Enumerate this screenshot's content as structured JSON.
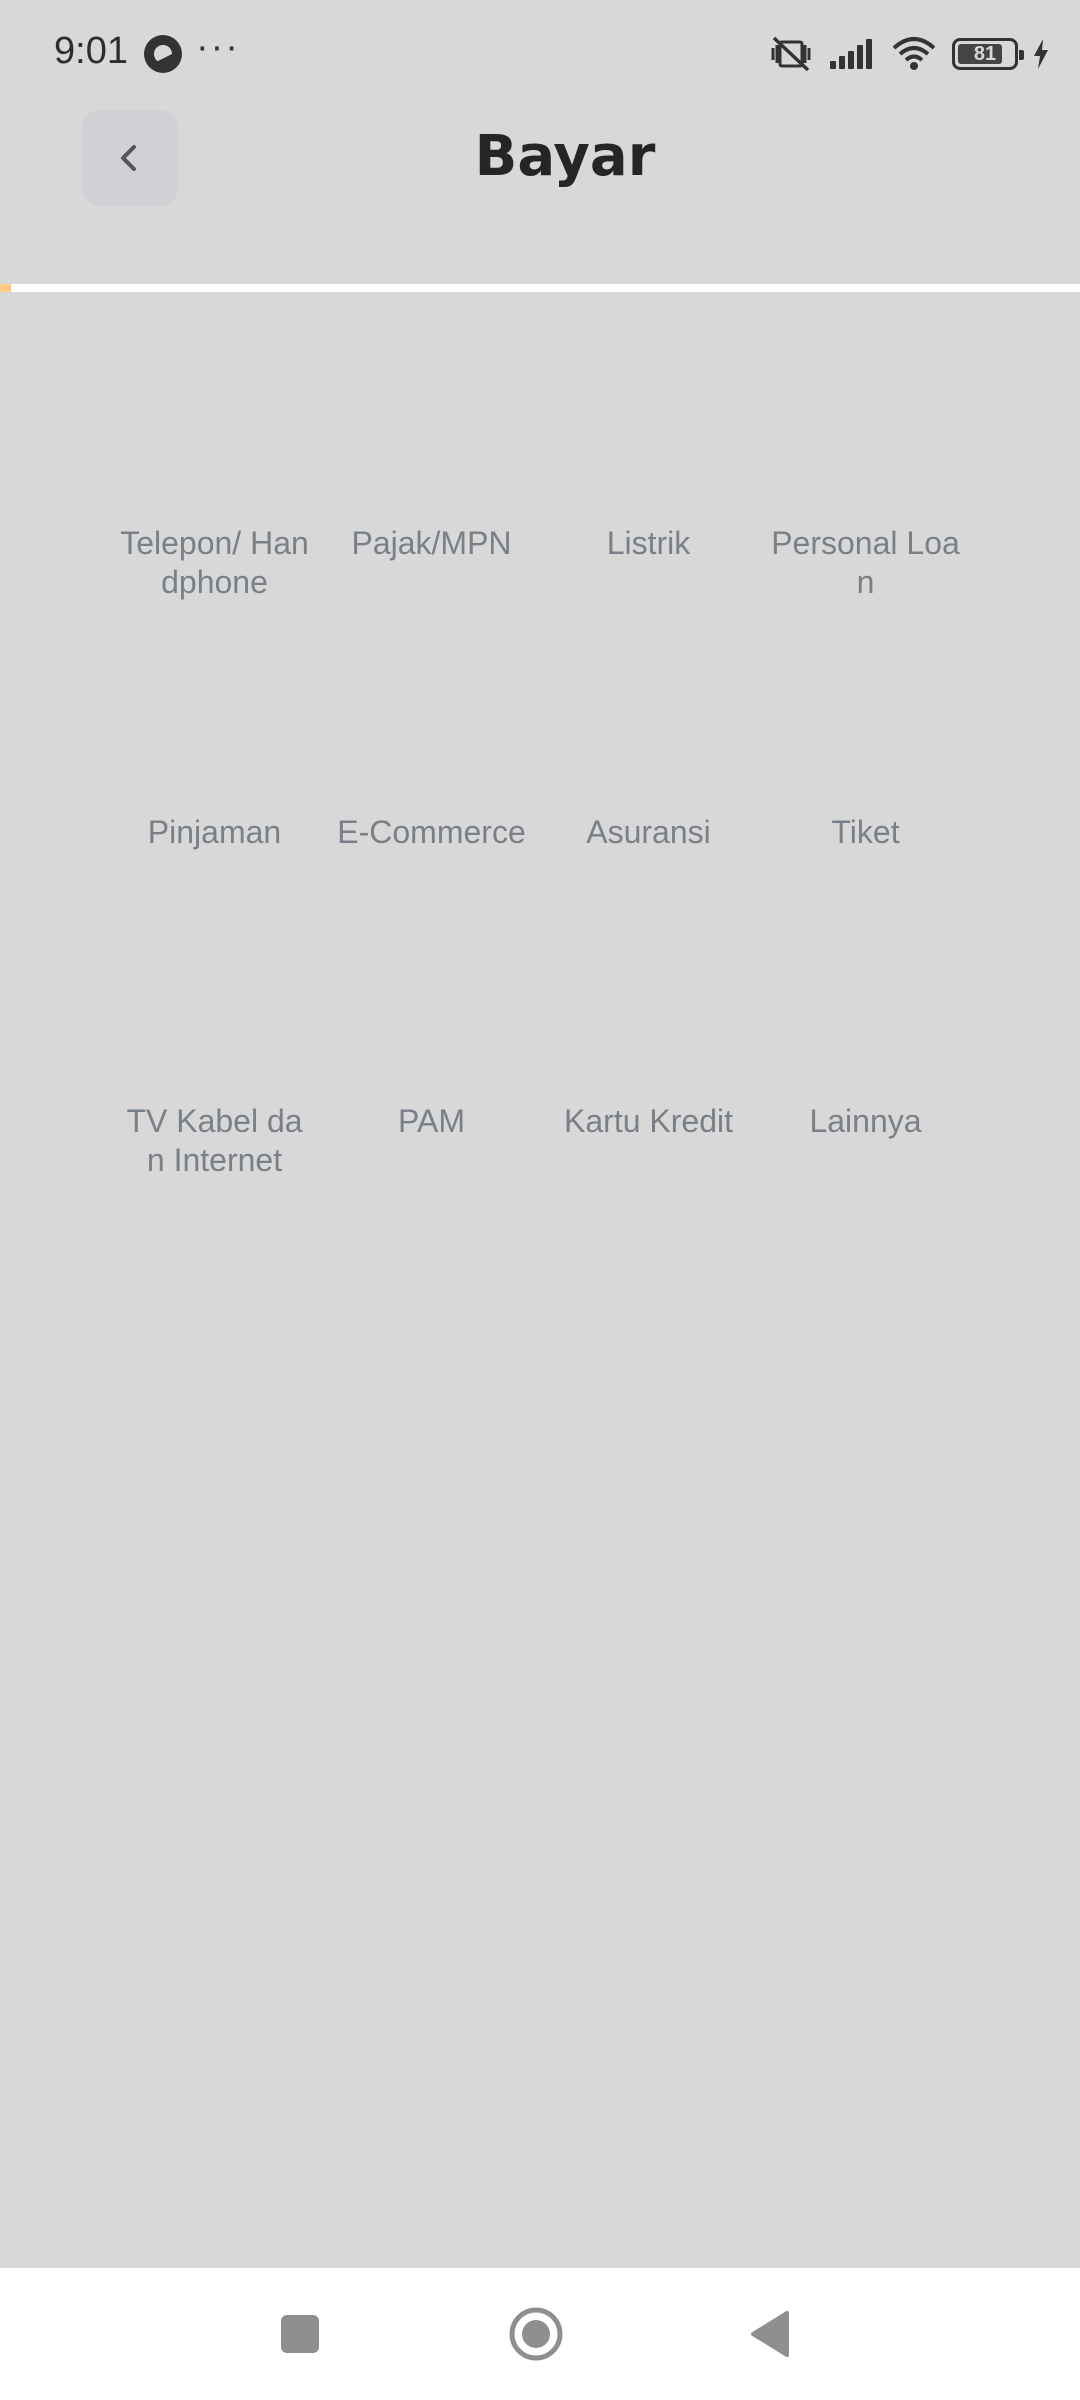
{
  "status_bar": {
    "time": "9:01",
    "more": "···",
    "battery_level": "81",
    "battery_fraction": 0.81
  },
  "header": {
    "title": "Bayar",
    "back_icon": "chevron-left-icon"
  },
  "progress": {
    "fraction": 0.01,
    "color": "#ffc987"
  },
  "grid": {
    "items": [
      {
        "label": "Telepon/ Handphone"
      },
      {
        "label": "Pajak/MPN"
      },
      {
        "label": "Listrik"
      },
      {
        "label": "Personal Loan"
      },
      {
        "label": "Pinjaman"
      },
      {
        "label": "E-Commerce"
      },
      {
        "label": "Asuransi"
      },
      {
        "label": "Tiket"
      },
      {
        "label": "TV Kabel dan Internet"
      },
      {
        "label": "PAM"
      },
      {
        "label": "Kartu Kredit"
      },
      {
        "label": "Lainnya"
      }
    ]
  },
  "nav": {
    "recent_icon": "square-icon",
    "home_icon": "circle-icon",
    "back_icon": "triangle-back-icon"
  },
  "colors": {
    "background": "#d8d8d8",
    "label": "#7a8088",
    "title": "#252525"
  }
}
